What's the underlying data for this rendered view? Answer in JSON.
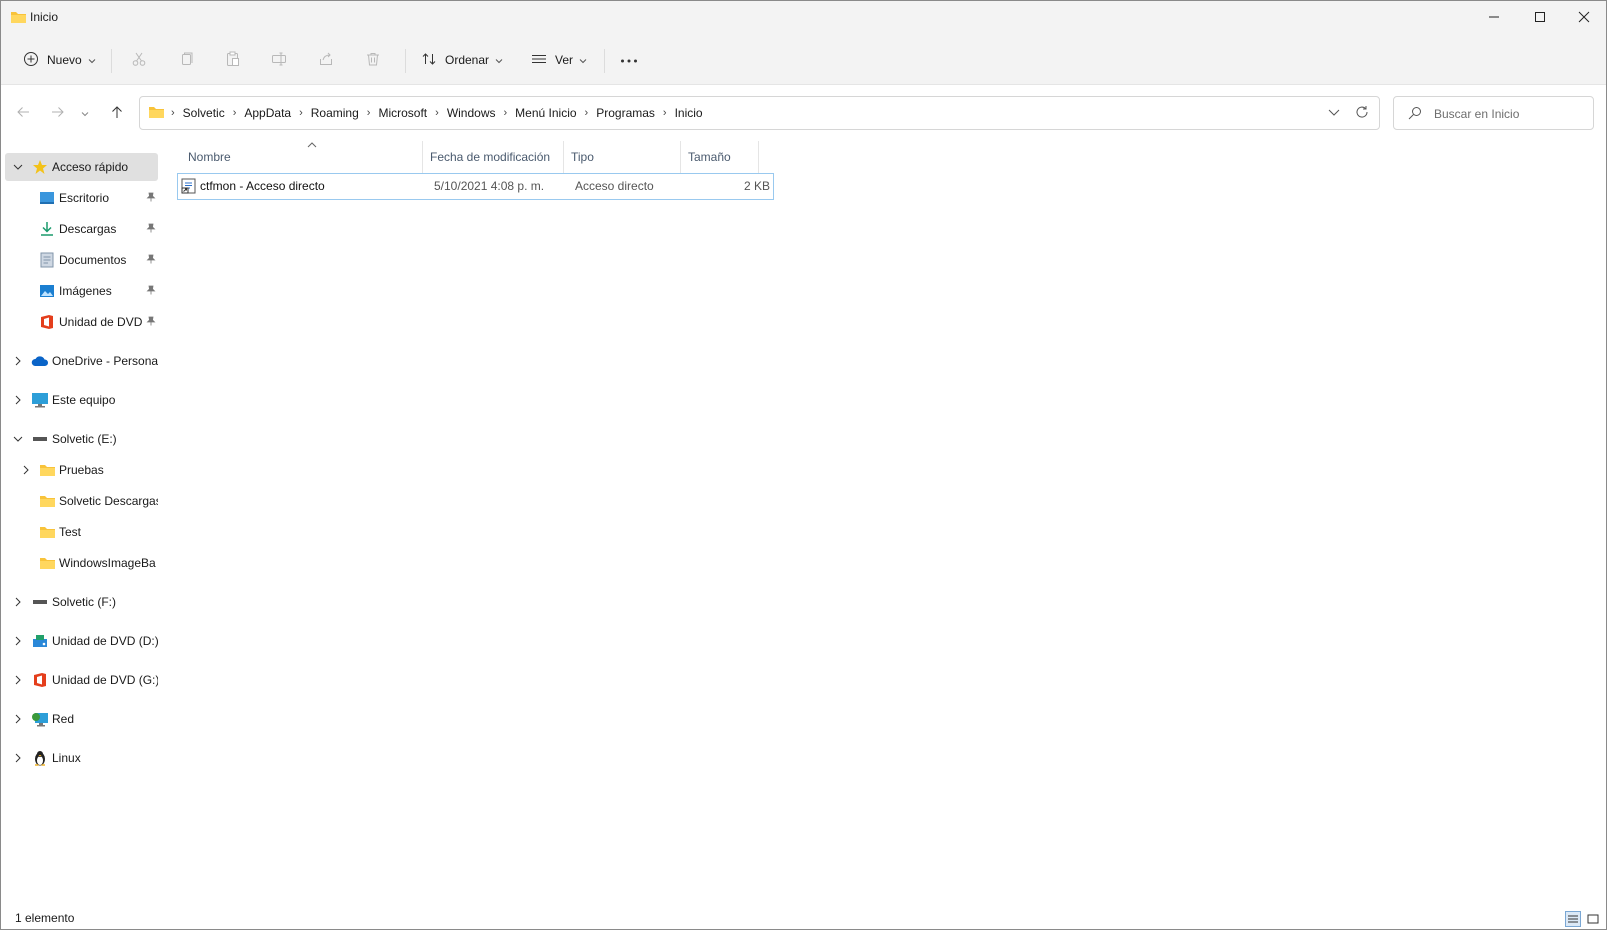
{
  "window": {
    "title": "Inicio"
  },
  "command_bar": {
    "new_label": "Nuevo",
    "sort_label": "Ordenar",
    "view_label": "Ver",
    "more_label": "···",
    "icons": [
      "cut-icon",
      "copy-icon",
      "paste-icon",
      "rename-icon",
      "share-icon",
      "delete-icon"
    ]
  },
  "address": {
    "crumbs": [
      "Solvetic",
      "AppData",
      "Roaming",
      "Microsoft",
      "Windows",
      "Menú Inicio",
      "Programas",
      "Inicio"
    ]
  },
  "search": {
    "placeholder": "Buscar en Inicio"
  },
  "sidebar": {
    "quick_access": {
      "label": "Acceso rápido",
      "items": [
        {
          "label": "Escritorio",
          "icon": "desktop-icon"
        },
        {
          "label": "Descargas",
          "icon": "download-icon"
        },
        {
          "label": "Documentos",
          "icon": "documents-icon"
        },
        {
          "label": "Imágenes",
          "icon": "pictures-icon"
        },
        {
          "label": "Unidad de DVD",
          "icon": "office-icon"
        }
      ]
    },
    "onedrive": {
      "label": "OneDrive - Personal"
    },
    "this_pc": {
      "label": "Este equipo"
    },
    "drive_e": {
      "label": "Solvetic (E:)",
      "children": [
        "Pruebas",
        "Solvetic Descargas",
        "Test",
        "WindowsImageBa"
      ]
    },
    "drive_f": {
      "label": "Solvetic (F:)"
    },
    "dvd_d": {
      "label": "Unidad de DVD (D:)"
    },
    "dvd_g": {
      "label": "Unidad de DVD (G:)"
    },
    "network": {
      "label": "Red"
    },
    "linux": {
      "label": "Linux"
    }
  },
  "file_list": {
    "columns": [
      "Nombre",
      "Fecha de modificación",
      "Tipo",
      "Tamaño"
    ],
    "rows": [
      {
        "name": "ctfmon - Acceso directo",
        "modified": "5/10/2021 4:08 p. m.",
        "type": "Acceso directo",
        "size": "2 KB"
      }
    ]
  },
  "status": {
    "count": "1 elemento"
  },
  "colors": {
    "folder": "#f8c33a",
    "accent": "#0067c0",
    "selected_row_border": "#99c9ef",
    "nav_selected": "#e0e0e0"
  }
}
